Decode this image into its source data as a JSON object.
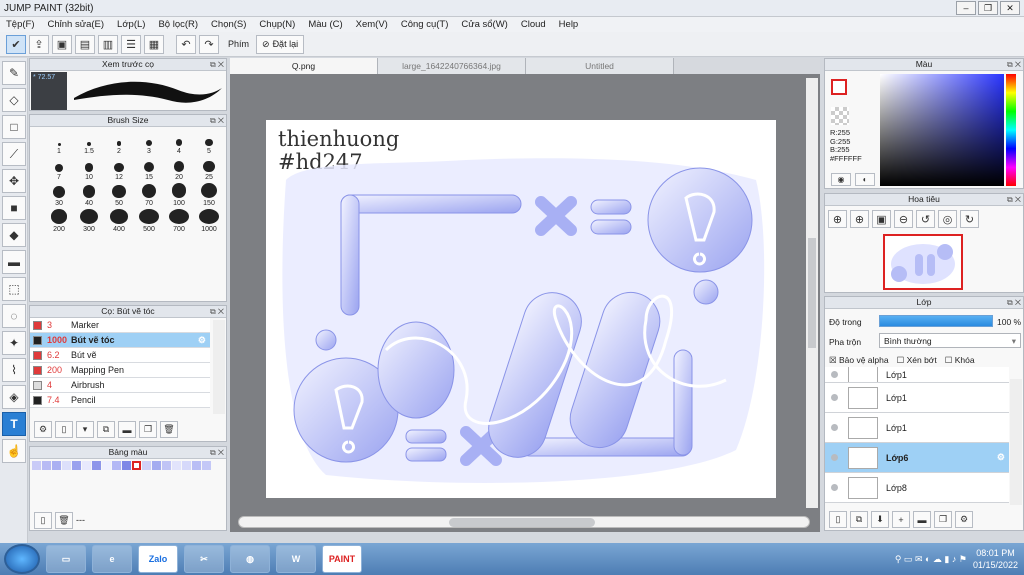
{
  "window": {
    "title": "JUMP PAINT (32bit)",
    "minimize": "–",
    "restore": "❐",
    "close": "✕"
  },
  "menu": [
    "Tệp(F)",
    "Chỉnh sửa(E)",
    "Lớp(L)",
    "Bộ lọc(R)",
    "Chọn(S)",
    "Chụp(N)",
    "Màu (C)",
    "Xem(V)",
    "Công cụ(T)",
    "Cửa sổ(W)",
    "Cloud",
    "Help"
  ],
  "toolbar": {
    "phim_label": "Phím",
    "reset_label": "Đặt lại"
  },
  "panels": {
    "brush_preview": {
      "title": "Xem trước cọ",
      "size_readout": "* 72.57"
    },
    "brush_size": {
      "title": "Brush Size",
      "sizes": [
        "1",
        "1.5",
        "2",
        "3",
        "4",
        "5",
        "7",
        "10",
        "12",
        "15",
        "20",
        "25",
        "30",
        "40",
        "50",
        "70",
        "100",
        "150",
        "200",
        "300",
        "400",
        "500",
        "700",
        "1000"
      ]
    },
    "brush_list": {
      "title": "Cọ: Bút vẽ tóc",
      "items": [
        {
          "size": "3",
          "name": "Marker",
          "color": "#e03a3a"
        },
        {
          "size": "1000",
          "name": "Bút vẽ tóc",
          "color": "#222222"
        },
        {
          "size": "6.2",
          "name": "Bút vẽ",
          "color": "#e03a3a"
        },
        {
          "size": "200",
          "name": "Mapping Pen",
          "color": "#e03a3a"
        },
        {
          "size": "4",
          "name": "Airbrush",
          "color": "#dddddd"
        },
        {
          "size": "7.4",
          "name": "Pencil",
          "color": "#222222"
        }
      ]
    },
    "palette": {
      "title": "Bảng màu",
      "footer": "---"
    },
    "color": {
      "title": "Màu",
      "r": "R:255",
      "g": "G:255",
      "b": "B:255",
      "hex": "#FFFFFF"
    },
    "navigator": {
      "title": "Hoa tiêu"
    },
    "layers": {
      "title": "Lớp",
      "opacity_label": "Độ trong",
      "opacity_value": "100 %",
      "opacity": 1.0,
      "blend_label": "Pha trộn",
      "blend_value": "Bình thường",
      "protect_alpha": "Bảo vệ alpha",
      "clip": "Xén bớt",
      "lock": "Khóa",
      "items": [
        "Lớp1",
        "Lớp1",
        "Lớp1",
        "Lớp6",
        "Lớp8"
      ]
    }
  },
  "tabs": [
    "Q.png",
    "large_1642240766364.jpg",
    "Untitled"
  ],
  "canvas": {
    "signature_line1": "thienhuong",
    "signature_line2": "#hd247"
  },
  "taskbar": {
    "zalo": "Zalo",
    "word": "W",
    "paint": "PAINT",
    "time": "08:01 PM",
    "date": "01/15/2022"
  },
  "colors": {
    "accent": "#2a7fd4",
    "selection": "#9ed0f5",
    "art": "#c8ccf8"
  }
}
